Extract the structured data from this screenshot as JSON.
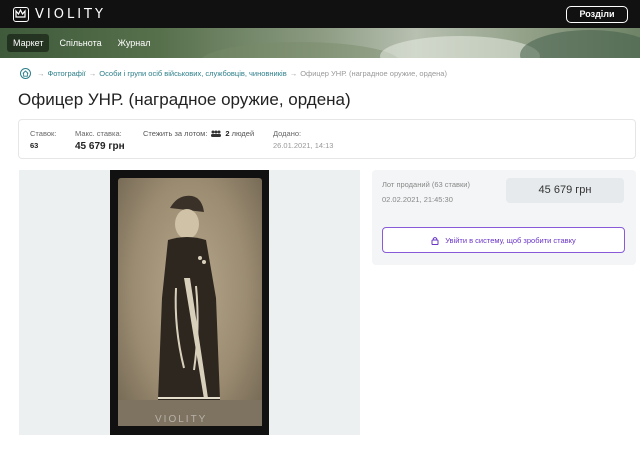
{
  "header": {
    "logo_text": "VIOLITY",
    "sections_button": "Розділи"
  },
  "nav": {
    "items": [
      {
        "label": "Маркет",
        "active": true
      },
      {
        "label": "Спільнота",
        "active": false
      },
      {
        "label": "Журнал",
        "active": false
      }
    ]
  },
  "breadcrumb": {
    "items": [
      "Фотографії",
      "Особи і групи осіб військових, службовців, чиновників",
      "Офицер УНР. (наградное оружие, ордена)"
    ]
  },
  "lot": {
    "title": "Офицер УНР. (наградное оружие, ордена)"
  },
  "stats": {
    "bids_label": "Ставок:",
    "bids_value": "63",
    "max_bid_label": "Макс. ставка:",
    "max_bid_value": "45 679 грн",
    "watch_label": "Стежить за лотом:",
    "watch_count": "2",
    "watch_suffix": "людей",
    "added_label": "Додано:",
    "added_value": "26.01.2021, 14:13"
  },
  "image": {
    "watermark": "VIOLITY"
  },
  "sale": {
    "status": "Лот проданий (63 ставки)",
    "date": "02.02.2021, 21:45:30",
    "price": "45 679 грн",
    "login_button": "Увійти в систему, щоб зробити ставку"
  },
  "colors": {
    "accent": "#2d7f8a",
    "button_purple": "#6a35c7"
  }
}
